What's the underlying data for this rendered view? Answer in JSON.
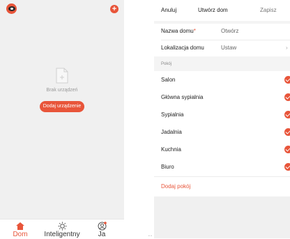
{
  "left": {
    "empty_text": "Brak urządzeń",
    "add_device_label": "Dodaj urządzenie",
    "add_icon_glyph": "+",
    "nav": [
      {
        "label": "Dom",
        "icon": "home-icon",
        "active": true
      },
      {
        "label": "Inteligentny",
        "icon": "sun-icon",
        "active": false
      },
      {
        "label": "Ja",
        "icon": "profile-icon",
        "active": false
      }
    ],
    "stray_text": "• •"
  },
  "right": {
    "header": {
      "cancel": "Anuluj",
      "title": "Utwórz dom",
      "save": "Zapisz"
    },
    "home_name": {
      "label": "Nazwa domu",
      "required_mark": "*",
      "value": "Otwórz"
    },
    "location": {
      "label": "Lokalizacja domu",
      "value": "Ustaw",
      "chevron": "›"
    },
    "rooms_section": "Pokój",
    "rooms": [
      "Salon",
      "Główna sypialnia",
      "Sypialnia",
      "Jadalnia",
      "Kuchnia",
      "Biuro"
    ],
    "add_room": "Dodaj pokój"
  },
  "colors": {
    "accent": "#e8553a",
    "background": "#f0f0f0"
  }
}
